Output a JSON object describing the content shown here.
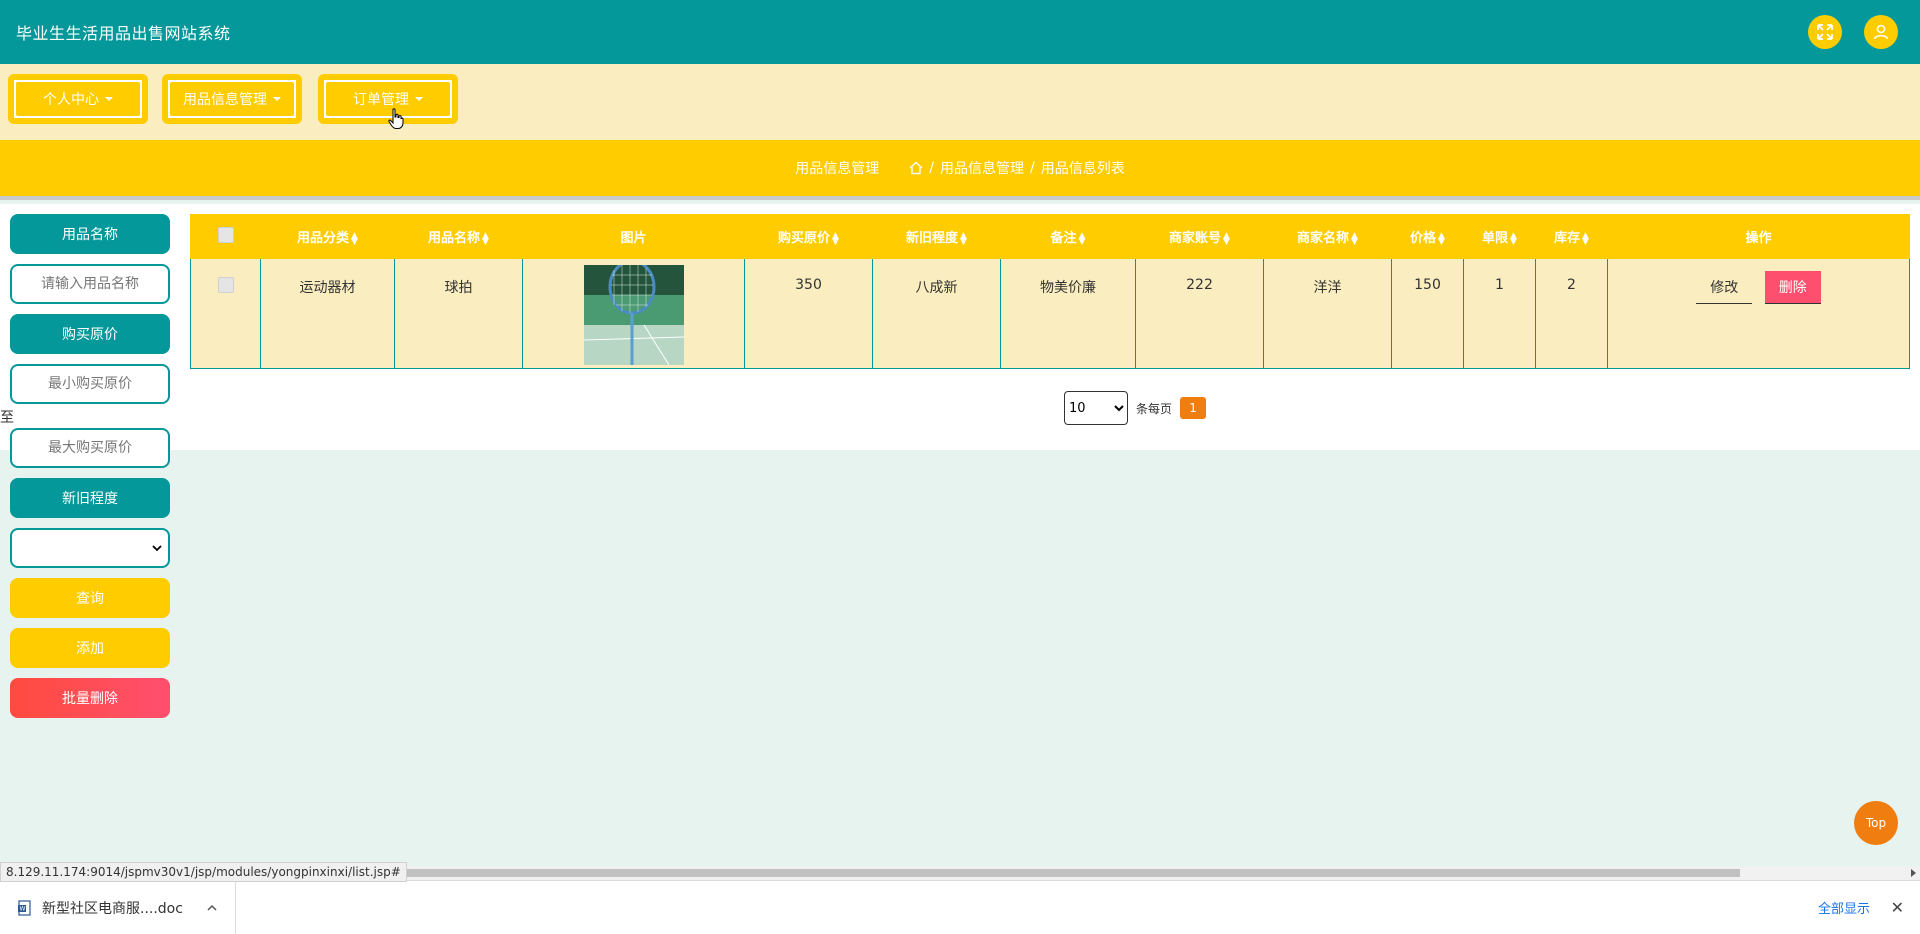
{
  "app": {
    "title": "毕业生生活用品出售网站系统",
    "icons": [
      "fullscreen-icon",
      "user-icon"
    ]
  },
  "nav": {
    "items": [
      {
        "label": "个人中心"
      },
      {
        "label": "用品信息管理"
      },
      {
        "label": "订单管理"
      }
    ]
  },
  "breadcrumb": {
    "section": "用品信息管理",
    "path": [
      "用品信息管理",
      "用品信息列表"
    ]
  },
  "search": {
    "name_label": "用品名称",
    "name_placeholder": "请输入用品名称",
    "price_label": "购买原价",
    "min_price_placeholder": "最小购买原价",
    "to_label": "至",
    "max_price_placeholder": "最大购买原价",
    "condition_label": "新旧程度",
    "condition_value": "",
    "query_button": "查询",
    "add_button": "添加",
    "batch_delete_button": "批量删除"
  },
  "table": {
    "headers": [
      "用品分类",
      "用品名称",
      "图片",
      "购买原价",
      "新旧程度",
      "备注",
      "商家账号",
      "商家名称",
      "价格",
      "单限",
      "库存",
      "操作"
    ],
    "rows": [
      {
        "category": "运动器材",
        "name": "球拍",
        "original_price": "350",
        "condition": "八成新",
        "remark": "物美价廉",
        "merchant_account": "222",
        "merchant_name": "洋洋",
        "price": "150",
        "limit": "1",
        "stock": "2",
        "edit_label": "修改",
        "delete_label": "删除"
      }
    ]
  },
  "pager": {
    "page_size": "10",
    "per_page_label": "条每页",
    "current_page": "1"
  },
  "top_button": "Top",
  "status_url": "8.129.11.174:9014/jspmv30v1/jsp/modules/yongpinxinxi/list.jsp#",
  "downloads": {
    "file_name": "新型社区电商服....doc",
    "show_all": "全部显示"
  },
  "colors": {
    "teal": "#04989a",
    "yellow": "#ffcc00",
    "cream": "#faedc0",
    "orange": "#ef7d10",
    "red": "#ff4f6e"
  }
}
